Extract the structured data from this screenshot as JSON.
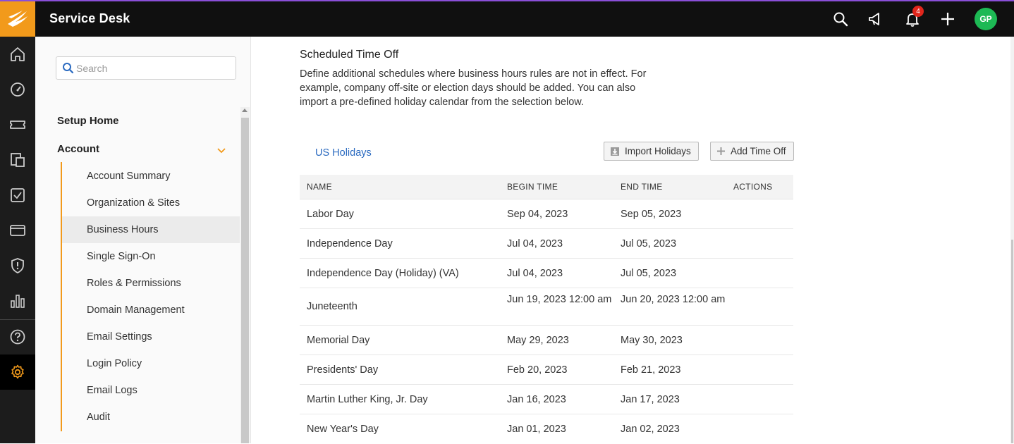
{
  "header": {
    "app_title": "Service Desk",
    "notification_count": "4",
    "avatar_initials": "GP",
    "colors": {
      "logo_bg": "#f29a1b",
      "avatar_bg": "#1db954",
      "badge_bg": "#e1261c",
      "accent": "#f29a1b"
    }
  },
  "rail": {
    "items": [
      "home-icon",
      "dashboard-icon",
      "ticket-icon",
      "assets-icon",
      "tasks-icon",
      "card-icon",
      "shield-icon",
      "reports-icon",
      "help-icon",
      "settings-icon"
    ]
  },
  "sidebar": {
    "search_placeholder": "Search",
    "setup_home": "Setup Home",
    "account_label": "Account",
    "items": [
      {
        "label": "Account Summary"
      },
      {
        "label": "Organization & Sites"
      },
      {
        "label": "Business Hours"
      },
      {
        "label": "Single Sign-On"
      },
      {
        "label": "Roles & Permissions"
      },
      {
        "label": "Domain Management"
      },
      {
        "label": "Email Settings"
      },
      {
        "label": "Login Policy"
      },
      {
        "label": "Email Logs"
      },
      {
        "label": "Audit"
      }
    ],
    "active_item": "Business Hours"
  },
  "main": {
    "section_title": "Scheduled Time Off",
    "section_desc": "Define additional schedules where business hours rules are not in effect. For example, company off-site or election days should be added. You can also import a pre-defined holiday calendar from the selection below.",
    "tab_label": "US Holidays",
    "import_button": "Import Holidays",
    "add_button": "Add Time Off",
    "table": {
      "headers": {
        "name": "NAME",
        "begin": "BEGIN TIME",
        "end": "END TIME",
        "actions": "ACTIONS"
      },
      "rows": [
        {
          "name": "Labor Day",
          "begin": "Sep 04, 2023",
          "end": "Sep 05, 2023"
        },
        {
          "name": "Independence Day",
          "begin": "Jul 04, 2023",
          "end": "Jul 05, 2023"
        },
        {
          "name": "Independence Day (Holiday) (VA)",
          "begin": "Jul 04, 2023",
          "end": "Jul 05, 2023"
        },
        {
          "name": "Juneteenth",
          "begin": "Jun 19, 2023 12:00 am",
          "end": "Jun 20, 2023 12:00 am"
        },
        {
          "name": "Memorial Day",
          "begin": "May 29, 2023",
          "end": "May 30, 2023"
        },
        {
          "name": "Presidents' Day",
          "begin": "Feb 20, 2023",
          "end": "Feb 21, 2023"
        },
        {
          "name": "Martin Luther King, Jr. Day",
          "begin": "Jan 16, 2023",
          "end": "Jan 17, 2023"
        },
        {
          "name": "New Year's Day",
          "begin": "Jan 01, 2023",
          "end": "Jan 02, 2023"
        }
      ]
    }
  }
}
